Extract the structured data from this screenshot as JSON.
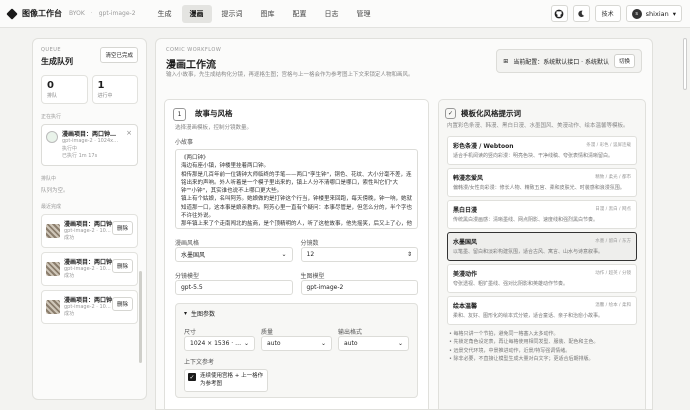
{
  "app": {
    "title": "图像工作台",
    "byok": "BYOK",
    "sep": "·",
    "model": "gpt-image-2"
  },
  "nav": [
    {
      "label": "生成",
      "active": false
    },
    {
      "label": "漫画",
      "active": true
    },
    {
      "label": "提示词",
      "active": false
    },
    {
      "label": "图库",
      "active": false
    },
    {
      "label": "配置",
      "active": false
    },
    {
      "label": "日志",
      "active": false
    },
    {
      "label": "管理",
      "active": false
    }
  ],
  "topright": {
    "theme_label": "技术",
    "user": "shixian"
  },
  "queue": {
    "eyebrow": "QUEUE",
    "title": "生成队列",
    "clear_label": "清空已完成",
    "stats": [
      {
        "num": "0",
        "label": "排队"
      },
      {
        "num": "1",
        "label": "进行中"
      }
    ],
    "running_title": "正在执行",
    "running_job": {
      "title": "漫画项目：两口钟…",
      "line1": "gpt-image-2 · 1024x…",
      "line2": "执行中",
      "line3": "已执行 1m 17s"
    },
    "waiting_title": "排队中",
    "waiting_empty": "队列为空。",
    "done_title": "最近完成",
    "done": [
      {
        "title": "漫画项目：两口钟…",
        "sub": "gpt-image-2 · 10…",
        "status": "成功",
        "del": "删除"
      },
      {
        "title": "漫画项目：两口钟…",
        "sub": "gpt-image-2 · 10…",
        "status": "成功",
        "del": "删除"
      },
      {
        "title": "漫画项目：两口钟…",
        "sub": "gpt-image-2 · 10…",
        "status": "成功",
        "del": "删除"
      }
    ]
  },
  "main": {
    "eyebrow": "COMIC WORKFLOW",
    "title": "漫画工作流",
    "desc": "输入小故事，先生成结构化分镜，再逐格生图；宫格与上一格会作为参考图上下文来锁定人物和画风。",
    "config_text": "当前配置：系统默认接口 · 系统默认",
    "config_switch": "切换"
  },
  "story": {
    "step": "1",
    "title": "故事与风格",
    "sub": "选择漫画模板，控制分镜数量。",
    "story_label": "小故事",
    "story_text": "《两口钟》\n海边有座小镇，钟楼里挂着两口钟。\n相传那是几百年前一位铸钟大师临终的手笔——两口\"孪生钟\"，铜色、花纹、大小分毫不差，连铭出来的声响。外人听着是一个模子里出来的，镇上人分不清哪口是哪口，索性叫它们\"大钟\"\"小钟\"，其实谁也说不上哪口更大些。\n镇上有个姑娘，名叫阿芳。她娘做的是打钟这个行当，钟楼里来回跑，每天傍晚，钟一响，她就知道那一口，这本事是娘亲教的。阿芳心里一直有个疑问：本事尽管是，但怎么分的，半个字也不许往外说。\n那年镇上来了个走南闯北的盐商，是个顶精明的人，听了这桩故事，他先摇笑，后又上了心，他要用这对钟的说法挂着钱的来处，就是拿这么一对孪生钟，对整个镇子来……",
    "style_label": "漫画风格",
    "style_value": "水墨国风",
    "panels_label": "分镜数",
    "panels_value": "12",
    "text_model_label": "分镜模型",
    "text_model_value": "gpt-5.5",
    "image_model_label": "生图模型",
    "image_model_value": "gpt-image-2",
    "params_title": "生图参数",
    "size_label": "尺寸",
    "size_value": "1024 × 1536 · …",
    "quality_label": "质量",
    "quality_value": "auto",
    "format_label": "输出格式",
    "format_value": "auto",
    "ref_label": "上下文参考",
    "ref_check": "连续使用宫格 + 上一格作为参考图"
  },
  "templates": {
    "step": "✓",
    "title": "模板化风格提示词",
    "sub": "内置彩色条漫、韩漫、黑白日漫、水墨国风、美漫动作、绘本温馨等模板。",
    "cards": [
      {
        "name": "彩色条漫 / Webtoon",
        "tags": "条漫 / 彩色 / 竖屏连载",
        "desc": "适合手机阅读的竖向彩漫：明亮色块、干净线稿、夸张表情和清晰留白。",
        "selected": false
      },
      {
        "name": "韩漫恋爱风",
        "tags": "精致 / 柔光 / 都市",
        "desc": "偏韩漫/女性向彩漫：修长人物、精致五官、柔和皮肤光、时装感和浪漫氛围。",
        "selected": false
      },
      {
        "name": "黑白日漫",
        "tags": "日漫 / 黑白 / 网点",
        "desc": "传统黑白漫画感：清晰墨线、网点阴影、速度线和强烈黑白节奏。",
        "selected": false
      },
      {
        "name": "水墨国风",
        "tags": "水墨 / 留白 / 东方",
        "desc": "以笔墨、留白和淡彩构建氛围，适合古风、寓言、山水与诗意叙事。",
        "selected": true
      },
      {
        "name": "美漫动作",
        "tags": "动作 / 超英 / 分镜",
        "desc": "夸张透视、粗犷墨线、强对比阴影和英雄动作节奏。",
        "selected": false
      },
      {
        "name": "绘本温馨",
        "tags": "温馨 / 绘本 / 柔和",
        "desc": "柔和、友好、图形化的绘本式分镜，适合童话、亲子和治愈小故事。",
        "selected": false
      }
    ],
    "bullets": [
      "每格只讲一个节拍，避免同一格塞入太多动作。",
      "先锁定角色设定表，再让每格使用相同发型、服装、配色和主色。",
      "远景交代环境，中景推进动作，近景/特写强调情绪。",
      "除非必要，不直接让模型生成大量对白文字；更适合后期排版。"
    ]
  }
}
